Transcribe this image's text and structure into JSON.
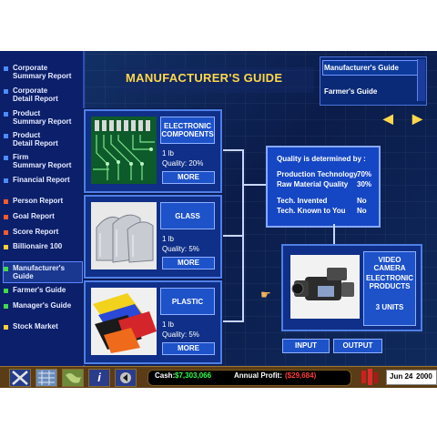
{
  "sidebar": {
    "items": [
      {
        "label": "Corporate\nSummary Report",
        "color": "#4f8bff"
      },
      {
        "label": "Corporate\nDetail Report",
        "color": "#4f8bff"
      },
      {
        "label": "Product\nSummary Report",
        "color": "#4f8bff"
      },
      {
        "label": "Product\nDetail Report",
        "color": "#4f8bff"
      },
      {
        "label": "Firm\nSummary Report",
        "color": "#4f8bff"
      },
      {
        "label": "Financial Report",
        "color": "#4f8bff"
      },
      {
        "label": "Person Report",
        "color": "#ff5a2a"
      },
      {
        "label": "Goal Report",
        "color": "#ff5a2a"
      },
      {
        "label": "Score Report",
        "color": "#ff5a2a"
      },
      {
        "label": "Billionaire 100",
        "color": "#ffcf33"
      },
      {
        "label": "Manufacturer's\nGuide",
        "color": "#44d94a"
      },
      {
        "label": "Farmer's Guide",
        "color": "#44d94a"
      },
      {
        "label": "Manager's Guide",
        "color": "#44d94a"
      },
      {
        "label": "Stock Market",
        "color": "#ffcf33"
      }
    ]
  },
  "header": {
    "title": "MANUFACTURER'S GUIDE"
  },
  "guide_list": {
    "items": [
      "Manufacturer's Guide",
      "Farmer's Guide"
    ]
  },
  "components": [
    {
      "name": "ELECTRONIC\nCOMPONENTS",
      "unit": "1 lb",
      "quality": "Quality: 20%",
      "more": "MORE"
    },
    {
      "name": "GLASS",
      "unit": "1 lb",
      "quality": "Quality: 5%",
      "more": "MORE"
    },
    {
      "name": "PLASTIC",
      "unit": "1 lb",
      "quality": "Quality: 5%",
      "more": "MORE"
    }
  ],
  "quality_panel": {
    "heading": "Quality is determined by :",
    "rows": [
      {
        "label": "Production Technology",
        "value": "70%"
      },
      {
        "label": "Raw Material Quality",
        "value": "30%"
      },
      {
        "label": "Tech. Invented",
        "value": "No"
      },
      {
        "label": "Tech. Known to You",
        "value": "No"
      }
    ]
  },
  "product": {
    "name": "VIDEO\nCAMERA",
    "category": "ELECTRONIC\nPRODUCTS",
    "units": "3 UNITS"
  },
  "buttons": {
    "input": "INPUT",
    "output": "OUTPUT"
  },
  "status": {
    "cash_label": "Cash:",
    "cash_value": "$7,303,066",
    "profit_label": "Annual Profit:",
    "profit_value": "($29,684)",
    "date_month_day": "Jun 24",
    "date_year": "2000"
  },
  "colors": {
    "accent": "#ffd84a",
    "panel": "#1d52c9",
    "profit_negative": "#ff3b3b",
    "cash": "#33ff4f"
  }
}
